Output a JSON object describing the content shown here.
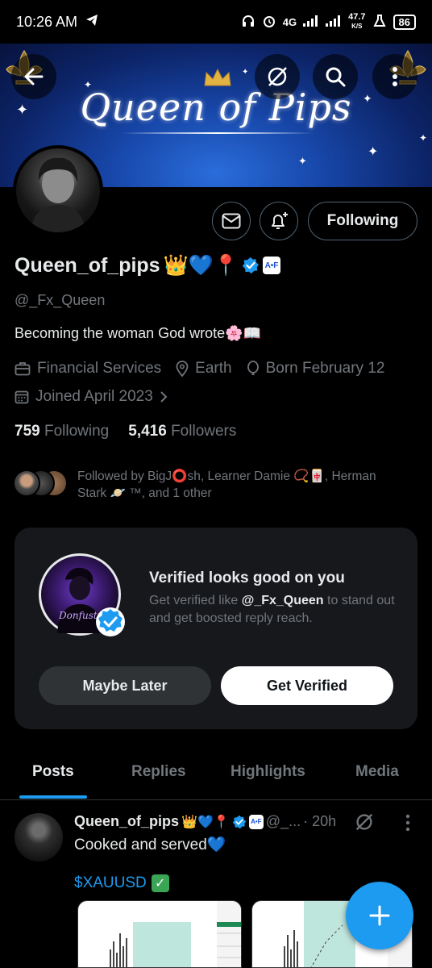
{
  "status_bar": {
    "time": "10:26 AM",
    "network": "4G",
    "speed_value": "47.7",
    "speed_unit": "K/S",
    "battery": "86"
  },
  "profile": {
    "name": "Queen_of_pips",
    "name_emojis": "👑💙📍",
    "handle": "@_Fx_Queen",
    "bio": "Becoming the woman God wrote🌸📖",
    "category": "Financial Services",
    "location": "Earth",
    "birthday": "Born February 12",
    "joined": "Joined April 2023",
    "following_count": "759",
    "following_label": "Following",
    "followers_count": "5,416",
    "followers_label": "Followers",
    "followed_by": "Followed by BigJ⭕sh, Learner Damie 📿🀄, Herman Stark 🪐 ™, and 1 other",
    "following_button": "Following",
    "affiliate_badge": "A•F"
  },
  "banner": {
    "title": "Queen of Pips"
  },
  "verified_card": {
    "title": "Verified looks good on you",
    "desc_prefix": "Get verified like ",
    "desc_handle": "@_Fx_Queen",
    "desc_suffix": " to stand out and get boosted reply reach.",
    "maybe_later": "Maybe Later",
    "get_verified": "Get Verified",
    "avatar_text": "Donfuster"
  },
  "tabs": [
    "Posts",
    "Replies",
    "Highlights",
    "Media"
  ],
  "post": {
    "name": "Queen_of_pips",
    "emojis": "👑💙📍",
    "handle": "@_...",
    "time": "· 20h",
    "text": "Cooked and served💙",
    "cashtag": "$XAUUSD",
    "check": "✓"
  },
  "colors": {
    "accent": "#1d9bf0",
    "background": "#000000",
    "muted": "#71767b",
    "card": "#16181c"
  }
}
